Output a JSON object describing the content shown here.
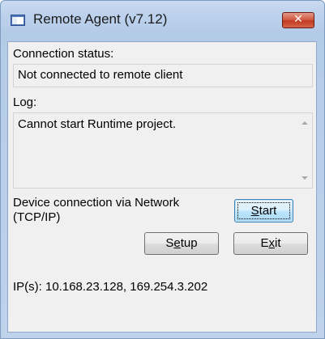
{
  "window": {
    "title": "Remote Agent (v7.12)",
    "close_label": "✕"
  },
  "connection": {
    "label": "Connection status:",
    "value": "Not connected to remote client"
  },
  "log": {
    "label": "Log:",
    "value": "Cannot start Runtime project."
  },
  "device": {
    "line1": "Device connection via Network",
    "line2": "(TCP/IP)"
  },
  "buttons": {
    "start_mnemonic": "S",
    "start_rest": "tart",
    "setup_prefix": "S",
    "setup_mnemonic": "e",
    "setup_rest": "tup",
    "exit_prefix": "E",
    "exit_mnemonic": "x",
    "exit_rest": "it"
  },
  "ip": {
    "text": "IP(s): 10.168.23.128, 169.254.3.202"
  },
  "icons": {
    "app": "app-window-icon",
    "close": "close-icon",
    "scroll_up": "scroll-up-arrow-icon",
    "scroll_down": "scroll-down-arrow-icon"
  },
  "colors": {
    "frame": "#b4cbe8",
    "close_button": "#c13b22",
    "default_button": "#bee6fd",
    "client_bg": "#f0f0f0"
  }
}
